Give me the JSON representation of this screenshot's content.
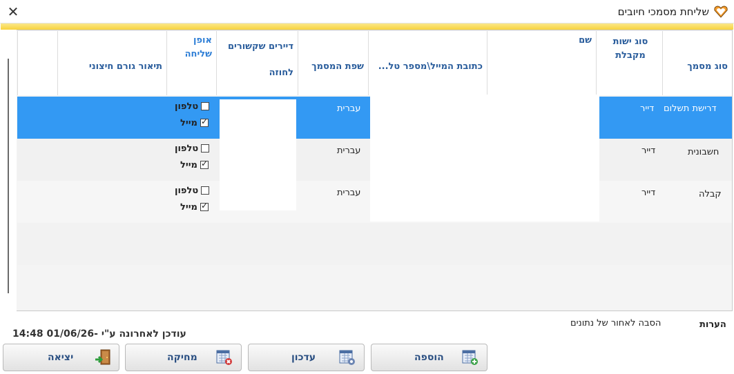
{
  "window": {
    "title": "שליחת מסמכי חיובים",
    "close_symbol": "✕"
  },
  "columns": {
    "doc_type": "סוג מסמך",
    "recipient_entity_type": "סוג ישות מקבלת",
    "name": "שם",
    "email_address": "כתובת המייל\\מספר טל...",
    "doc_language": "שפת המסמך",
    "linked_tenants": "דיירים שקשורים לחוזה",
    "send_method": "אופן שליחה",
    "external_party_desc": "תיאור גורם חיצוני"
  },
  "rows": [
    {
      "doc_type": "דרישת תשלום",
      "entity": "דייר",
      "language": "עברית",
      "phone_label": "טלפון",
      "phone_checked": false,
      "mail_label": "מייל",
      "mail_checked": true,
      "selected": true
    },
    {
      "doc_type": "חשבונית",
      "entity": "דייר",
      "language": "עברית",
      "phone_label": "טלפון",
      "phone_checked": false,
      "mail_label": "מייל",
      "mail_checked": true,
      "selected": false
    },
    {
      "doc_type": "קבלה",
      "entity": "דייר",
      "language": "עברית",
      "phone_label": "טלפון",
      "phone_checked": false,
      "mail_label": "מייל",
      "mail_checked": true,
      "selected": false
    }
  ],
  "footer": {
    "notes_label": "הערות",
    "notes_value": "הסבה לאחור של נתונים",
    "updated_text": "עודכן לאחרונה ע\"י -01/06/26 14:48"
  },
  "buttons": {
    "add": "הוספה",
    "update": "עדכון",
    "delete": "מחיקה",
    "exit": "יציאה"
  },
  "colors": {
    "selected_row": "#3399f3",
    "header_text": "#2a5d9c",
    "accent": "#f7d23d"
  }
}
